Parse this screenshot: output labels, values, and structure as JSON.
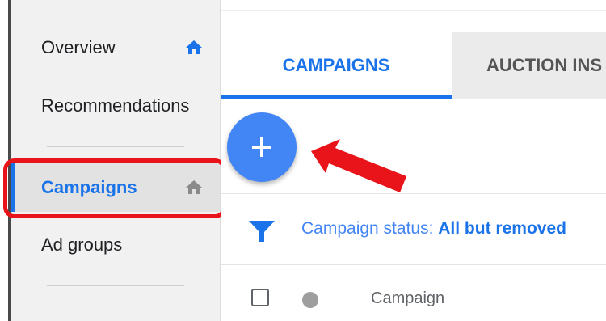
{
  "sidebar": {
    "items": [
      {
        "label": "Overview",
        "icon": "home-icon",
        "icon_color": "#1a73e8"
      },
      {
        "label": "Recommendations"
      },
      {
        "label": "Campaigns",
        "icon": "home-icon",
        "icon_color": "#8a8a8a",
        "selected": true
      },
      {
        "label": "Ad groups"
      }
    ]
  },
  "tabs": [
    {
      "label": "CAMPAIGNS",
      "active": true
    },
    {
      "label": "AUCTION INS"
    }
  ],
  "fab": {
    "icon": "plus-icon"
  },
  "filter": {
    "icon": "filter-icon",
    "prefix": "Campaign status:",
    "value": "All but removed"
  },
  "table": {
    "columns": [
      "Campaign"
    ]
  },
  "annotations": {
    "highlight_color": "#e8141a",
    "arrow_color": "#e8141a"
  },
  "colors": {
    "accent": "#1a73e8",
    "fab": "#4285f4"
  }
}
